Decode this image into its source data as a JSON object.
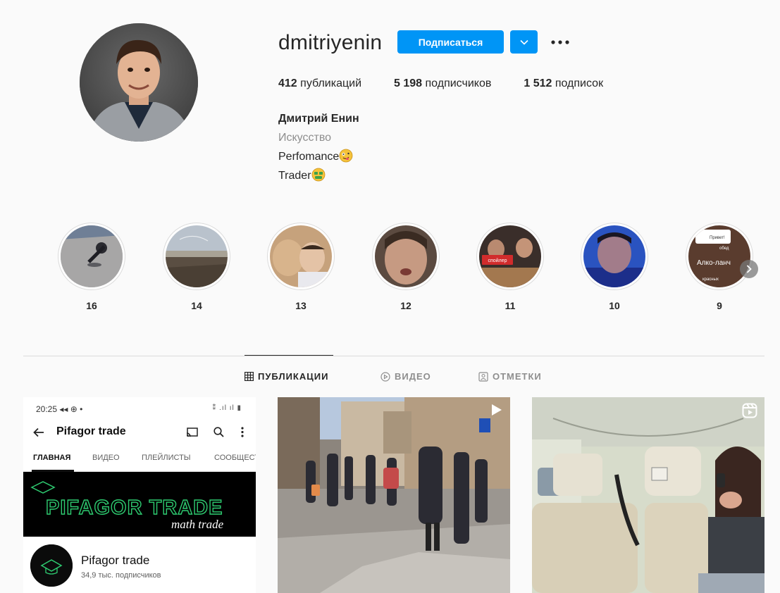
{
  "profile": {
    "username": "dmitriyenin",
    "follow_label": "Подписаться",
    "stats": [
      {
        "value": "412",
        "label": "публикаций"
      },
      {
        "value": "5 198",
        "label": "подписчиков"
      },
      {
        "value": "1 512",
        "label": "подписок"
      }
    ],
    "full_name": "Дмитрий Енин",
    "category": "Искусство",
    "bio_lines": [
      "Perfomance",
      "Trader"
    ]
  },
  "highlights": [
    {
      "label": "16"
    },
    {
      "label": "14"
    },
    {
      "label": "13"
    },
    {
      "label": "12"
    },
    {
      "label": "11"
    },
    {
      "label": "10"
    },
    {
      "label": "9"
    }
  ],
  "highlight_texts": {
    "h11": "спойлер",
    "h9_top": "Привет!",
    "h9_mid": "Алко-ланч",
    "h9_line1": "обед",
    "h9_line2": "красных"
  },
  "tabs": [
    {
      "label": "ПУБЛИКАЦИИ",
      "active": true
    },
    {
      "label": "ВИДЕО",
      "active": false
    },
    {
      "label": "ОТМЕТКИ",
      "active": false
    }
  ],
  "post1": {
    "time": "20:25",
    "status_icons": "◂◂ ⊕ •",
    "status_right": "⁑ .ıl ıl ▮",
    "channel_title": "Pifagor trade",
    "yt_tabs": [
      "ГЛАВНАЯ",
      "ВИДЕО",
      "ПЛЕЙЛИСТЫ",
      "СООБЩЕСТВ"
    ],
    "banner_title": "PIFAGOR TRADE",
    "banner_sub": "math trade",
    "channel_name": "Pifagor trade",
    "channel_subs": "34,9 тыс. подписчиков"
  },
  "colors": {
    "accent": "#0095f6",
    "text": "#262626",
    "muted": "#8e8e8e",
    "border": "#dbdbdb",
    "background": "#fafafa"
  }
}
